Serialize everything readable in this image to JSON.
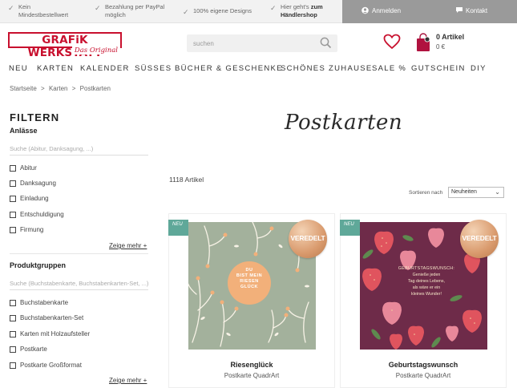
{
  "usps": [
    {
      "line1": "Kein",
      "line2": "Mindestbestellwert"
    },
    {
      "line1": "Bezahlung per PayPal",
      "line2": "möglich"
    },
    {
      "line1": "100% eigene Designs",
      "line2": ""
    },
    {
      "line1": "Hier geht's",
      "line1_bold": "zum",
      "line2": "Händlershop"
    }
  ],
  "account": {
    "login": "Anmelden",
    "contact": "Kontakt"
  },
  "logo": {
    "name": "GRAFiK WERKSTATT",
    "tagline": "Das Original"
  },
  "search": {
    "placeholder": "suchen"
  },
  "cart": {
    "title": "0 Artikel",
    "sum": "0 €"
  },
  "nav": [
    "NEU",
    "KARTEN",
    "KALENDER",
    "SÜSSES",
    "BÜCHER & GESCHENKE",
    "SCHÖNES ZUHAUSE",
    "SALE %",
    "GUTSCHEIN",
    "DIY"
  ],
  "breadcrumb": [
    "Startseite",
    ">",
    "Karten",
    ">",
    "Postkarten"
  ],
  "sidebar": {
    "title": "FILTERN",
    "groups": [
      {
        "title": "Anlässe",
        "search_placeholder": "Suche (Abitur, Danksagung, ...)",
        "options": [
          "Abitur",
          "Danksagung",
          "Einladung",
          "Entschuldigung",
          "Firmung"
        ],
        "more": "Zeige mehr +"
      },
      {
        "title": "Produktgruppen",
        "search_placeholder": "Suche (Buchstabenkarte, Buchstabenkarten-Set, ...)",
        "options": [
          "Buchstabenkarte",
          "Buchstabenkarten-Set",
          "Karten mit Holzaufsteller",
          "Postkarte",
          "Postkarte Großformat"
        ],
        "more": "Zeige mehr +"
      }
    ]
  },
  "main": {
    "title": "Postkarten",
    "count": "1118 Artikel",
    "sort_label": "Sortieren nach",
    "sort_value": "Neuheiten"
  },
  "products": [
    {
      "badge": "NEU",
      "seal": "VEREDELT",
      "name": "Riesenglück",
      "type": "Postkarte QuadrArt",
      "card_text": [
        "DU",
        "BIST MEIN",
        "RIESEN",
        "GLÜCK"
      ],
      "colors": {
        "bg": "#a3b19c",
        "accent": "#f2b07a",
        "leaf": "#f7f2e6"
      }
    },
    {
      "badge": "NEU",
      "seal": "VEREDELT",
      "name": "Geburtstagswunsch",
      "type": "Postkarte QuadrArt",
      "card_text": [
        "GEBURTSTAGSWUNSCH:",
        "Genieße jeden",
        "Tag deines Lebens,",
        "als wäre er ein",
        "kleines Wunder!"
      ],
      "colors": {
        "bg": "#6e2b49",
        "accent": "#e0545e",
        "leaf": "#5e8a4f"
      }
    }
  ]
}
